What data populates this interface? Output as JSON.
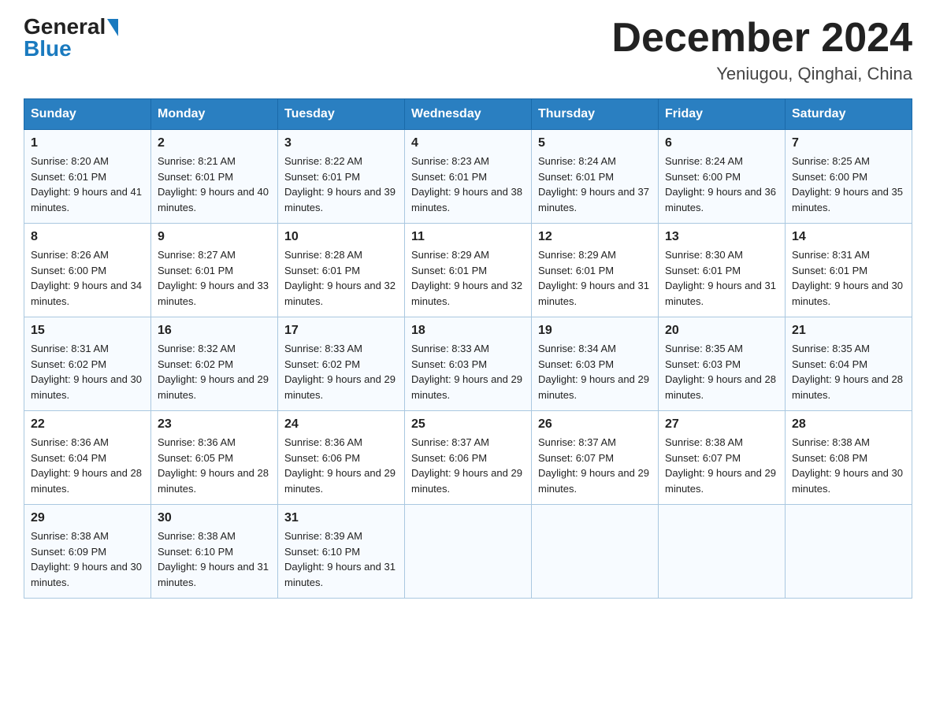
{
  "header": {
    "logo_general": "General",
    "logo_blue": "Blue",
    "month_title": "December 2024",
    "location": "Yeniugou, Qinghai, China"
  },
  "days_of_week": [
    "Sunday",
    "Monday",
    "Tuesday",
    "Wednesday",
    "Thursday",
    "Friday",
    "Saturday"
  ],
  "weeks": [
    [
      {
        "day": "1",
        "sunrise": "Sunrise: 8:20 AM",
        "sunset": "Sunset: 6:01 PM",
        "daylight": "Daylight: 9 hours and 41 minutes."
      },
      {
        "day": "2",
        "sunrise": "Sunrise: 8:21 AM",
        "sunset": "Sunset: 6:01 PM",
        "daylight": "Daylight: 9 hours and 40 minutes."
      },
      {
        "day": "3",
        "sunrise": "Sunrise: 8:22 AM",
        "sunset": "Sunset: 6:01 PM",
        "daylight": "Daylight: 9 hours and 39 minutes."
      },
      {
        "day": "4",
        "sunrise": "Sunrise: 8:23 AM",
        "sunset": "Sunset: 6:01 PM",
        "daylight": "Daylight: 9 hours and 38 minutes."
      },
      {
        "day": "5",
        "sunrise": "Sunrise: 8:24 AM",
        "sunset": "Sunset: 6:01 PM",
        "daylight": "Daylight: 9 hours and 37 minutes."
      },
      {
        "day": "6",
        "sunrise": "Sunrise: 8:24 AM",
        "sunset": "Sunset: 6:00 PM",
        "daylight": "Daylight: 9 hours and 36 minutes."
      },
      {
        "day": "7",
        "sunrise": "Sunrise: 8:25 AM",
        "sunset": "Sunset: 6:00 PM",
        "daylight": "Daylight: 9 hours and 35 minutes."
      }
    ],
    [
      {
        "day": "8",
        "sunrise": "Sunrise: 8:26 AM",
        "sunset": "Sunset: 6:00 PM",
        "daylight": "Daylight: 9 hours and 34 minutes."
      },
      {
        "day": "9",
        "sunrise": "Sunrise: 8:27 AM",
        "sunset": "Sunset: 6:01 PM",
        "daylight": "Daylight: 9 hours and 33 minutes."
      },
      {
        "day": "10",
        "sunrise": "Sunrise: 8:28 AM",
        "sunset": "Sunset: 6:01 PM",
        "daylight": "Daylight: 9 hours and 32 minutes."
      },
      {
        "day": "11",
        "sunrise": "Sunrise: 8:29 AM",
        "sunset": "Sunset: 6:01 PM",
        "daylight": "Daylight: 9 hours and 32 minutes."
      },
      {
        "day": "12",
        "sunrise": "Sunrise: 8:29 AM",
        "sunset": "Sunset: 6:01 PM",
        "daylight": "Daylight: 9 hours and 31 minutes."
      },
      {
        "day": "13",
        "sunrise": "Sunrise: 8:30 AM",
        "sunset": "Sunset: 6:01 PM",
        "daylight": "Daylight: 9 hours and 31 minutes."
      },
      {
        "day": "14",
        "sunrise": "Sunrise: 8:31 AM",
        "sunset": "Sunset: 6:01 PM",
        "daylight": "Daylight: 9 hours and 30 minutes."
      }
    ],
    [
      {
        "day": "15",
        "sunrise": "Sunrise: 8:31 AM",
        "sunset": "Sunset: 6:02 PM",
        "daylight": "Daylight: 9 hours and 30 minutes."
      },
      {
        "day": "16",
        "sunrise": "Sunrise: 8:32 AM",
        "sunset": "Sunset: 6:02 PM",
        "daylight": "Daylight: 9 hours and 29 minutes."
      },
      {
        "day": "17",
        "sunrise": "Sunrise: 8:33 AM",
        "sunset": "Sunset: 6:02 PM",
        "daylight": "Daylight: 9 hours and 29 minutes."
      },
      {
        "day": "18",
        "sunrise": "Sunrise: 8:33 AM",
        "sunset": "Sunset: 6:03 PM",
        "daylight": "Daylight: 9 hours and 29 minutes."
      },
      {
        "day": "19",
        "sunrise": "Sunrise: 8:34 AM",
        "sunset": "Sunset: 6:03 PM",
        "daylight": "Daylight: 9 hours and 29 minutes."
      },
      {
        "day": "20",
        "sunrise": "Sunrise: 8:35 AM",
        "sunset": "Sunset: 6:03 PM",
        "daylight": "Daylight: 9 hours and 28 minutes."
      },
      {
        "day": "21",
        "sunrise": "Sunrise: 8:35 AM",
        "sunset": "Sunset: 6:04 PM",
        "daylight": "Daylight: 9 hours and 28 minutes."
      }
    ],
    [
      {
        "day": "22",
        "sunrise": "Sunrise: 8:36 AM",
        "sunset": "Sunset: 6:04 PM",
        "daylight": "Daylight: 9 hours and 28 minutes."
      },
      {
        "day": "23",
        "sunrise": "Sunrise: 8:36 AM",
        "sunset": "Sunset: 6:05 PM",
        "daylight": "Daylight: 9 hours and 28 minutes."
      },
      {
        "day": "24",
        "sunrise": "Sunrise: 8:36 AM",
        "sunset": "Sunset: 6:06 PM",
        "daylight": "Daylight: 9 hours and 29 minutes."
      },
      {
        "day": "25",
        "sunrise": "Sunrise: 8:37 AM",
        "sunset": "Sunset: 6:06 PM",
        "daylight": "Daylight: 9 hours and 29 minutes."
      },
      {
        "day": "26",
        "sunrise": "Sunrise: 8:37 AM",
        "sunset": "Sunset: 6:07 PM",
        "daylight": "Daylight: 9 hours and 29 minutes."
      },
      {
        "day": "27",
        "sunrise": "Sunrise: 8:38 AM",
        "sunset": "Sunset: 6:07 PM",
        "daylight": "Daylight: 9 hours and 29 minutes."
      },
      {
        "day": "28",
        "sunrise": "Sunrise: 8:38 AM",
        "sunset": "Sunset: 6:08 PM",
        "daylight": "Daylight: 9 hours and 30 minutes."
      }
    ],
    [
      {
        "day": "29",
        "sunrise": "Sunrise: 8:38 AM",
        "sunset": "Sunset: 6:09 PM",
        "daylight": "Daylight: 9 hours and 30 minutes."
      },
      {
        "day": "30",
        "sunrise": "Sunrise: 8:38 AM",
        "sunset": "Sunset: 6:10 PM",
        "daylight": "Daylight: 9 hours and 31 minutes."
      },
      {
        "day": "31",
        "sunrise": "Sunrise: 8:39 AM",
        "sunset": "Sunset: 6:10 PM",
        "daylight": "Daylight: 9 hours and 31 minutes."
      },
      null,
      null,
      null,
      null
    ]
  ]
}
